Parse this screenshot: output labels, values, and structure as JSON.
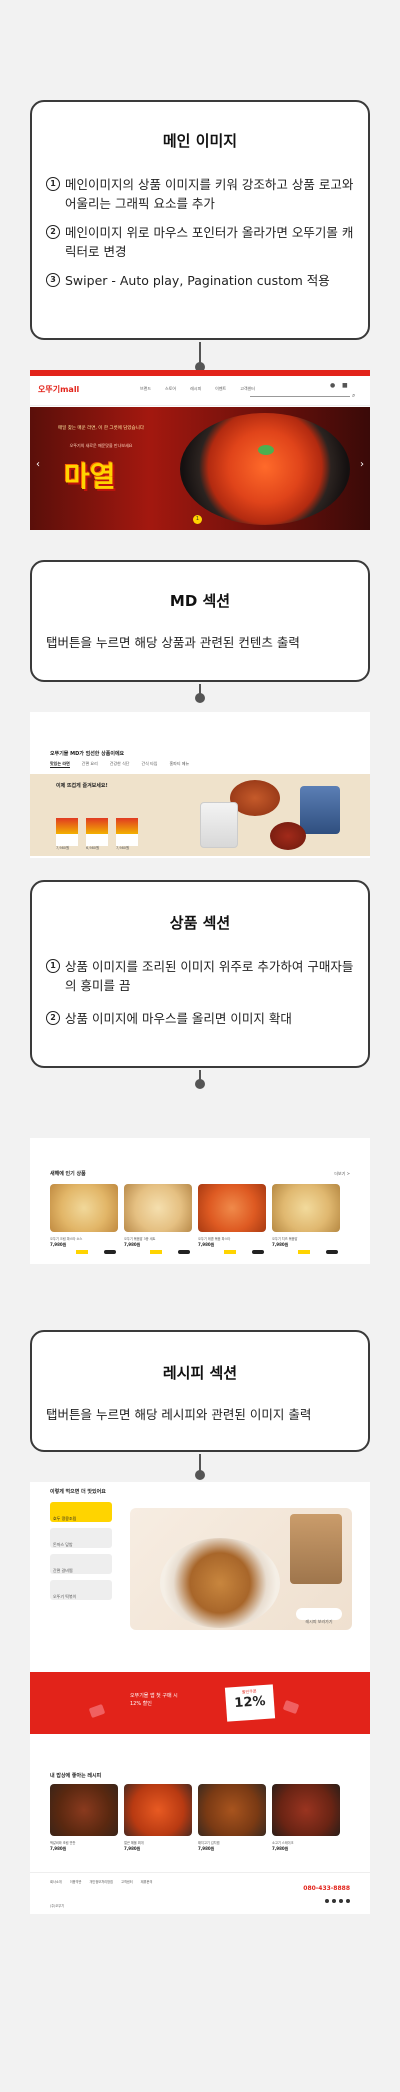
{
  "section_main": {
    "title": "메인 이미지",
    "items": [
      {
        "num": "1",
        "text": "메인이미지의 상품 이미지를 키워 강조하고 상품 로고와 어울리는 그래픽 요소를 추가"
      },
      {
        "num": "2",
        "text": "메인이미지 위로 마우스 포인터가 올라가면 오뚜기몰 캐릭터로 변경"
      },
      {
        "num": "3",
        "text": "Swiper - Auto play, Pagination custom 적용"
      }
    ]
  },
  "hero_shot": {
    "logo": "오뚜기mall",
    "nav": [
      "브랜드",
      "스토어",
      "레시피",
      "이벤트",
      "고객센터"
    ],
    "banner_copy": "매일 찾는 매운 라면, 이 한 그릇에 담았습니다",
    "banner_sub": "오뚜기의 새로운 매운맛을 만나보세요",
    "banner_logo": "마열"
  },
  "section_md": {
    "title": "MD 섹션",
    "desc": "탭버튼을 누르면 해당 상품과 관련된 컨텐츠 출력"
  },
  "md_shot": {
    "heading": "오뚜기몰 MD가 엄선한 상품이에요",
    "tabs": [
      "맛있는 라면",
      "간편 요리",
      "건강한 식단",
      "간식 타임",
      "홈파티 메뉴"
    ],
    "feature": "이제 뜨겁게 즐겨보세요!",
    "prices": [
      "7,980원",
      "6,980원",
      "7,980원"
    ]
  },
  "section_product": {
    "title": "상품 섹션",
    "items": [
      {
        "num": "1",
        "text": "상품 이미지를 조리된 이미지 위주로 추가하여 구매자들의 흥미를 끔"
      },
      {
        "num": "2",
        "text": "상품 이미지에 마우스를 올리면 이미지 확대"
      }
    ]
  },
  "product_shot": {
    "heading": "새해에 인기 상품",
    "more": "더보기 >",
    "items": [
      {
        "name": "오뚜기 크림 파스타 소스",
        "price": "7,980원"
      },
      {
        "name": "오뚜기 볶음밥 3종 세트",
        "price": "7,980원"
      },
      {
        "name": "오뚜기 매콤 볶음 파스타",
        "price": "7,980원"
      },
      {
        "name": "오뚜기 치즈 볶음밥",
        "price": "7,980원"
      }
    ]
  },
  "section_recipe": {
    "title": "레시피 섹션",
    "desc": "탭버튼을 누르면 해당 레시피와 관련된 이미지 출력"
  },
  "recipe_shot": {
    "heading": "이렇게 먹으면 더 맛있어요",
    "tabs": [
      "호두 땅콩조림",
      "돈까스 덮밥",
      "간편 갈비찜",
      "오뚜기 떡볶이"
    ],
    "btn": "레시피 보러가기",
    "promo_text": "오뚜기몰 앱 첫 구매 시\n12% 할인",
    "promo_badge_label": "할인쿠폰",
    "promo_badge": "12%",
    "list_heading": "내 밥상에 좋아는 레시피",
    "list_items": [
      {
        "name": "떡갈비와 조림 반찬",
        "price": "7,980원"
      },
      {
        "name": "얼큰 해물 찌개",
        "price": "7,980원"
      },
      {
        "name": "돼지고기 김치찜",
        "price": "7,980원"
      },
      {
        "name": "소고기 스테이크",
        "price": "7,980원"
      }
    ],
    "footer_links": [
      "회사소개",
      "이용약관",
      "개인정보처리방침",
      "고객센터",
      "제휴문의"
    ],
    "footer_phone": "080-433-8888",
    "footer_company": "(주)오뚜기"
  },
  "colors": {
    "brand_red": "#e2231a",
    "brand_yellow": "#ffd400",
    "connector": "#555555"
  }
}
